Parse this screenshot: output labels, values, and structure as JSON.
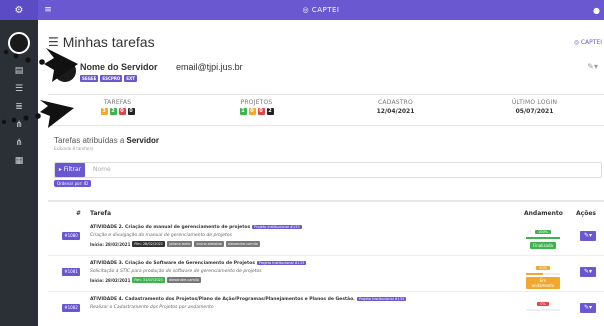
{
  "topbar": {
    "menu_icon": "menu-icon",
    "brand": "CAPTEI",
    "user_icon": "user-icon"
  },
  "sidebar": {
    "icons": [
      "users-icon",
      "list-icon",
      "list-icon",
      "sitemap-icon",
      "sitemap-icon",
      "screens-icon"
    ]
  },
  "page": {
    "title": "Minhas tarefas",
    "right_link": "CAPTEI"
  },
  "profile": {
    "name": "Nome do Servidor",
    "email": "email@tjpi.jus.br",
    "badges": [
      "SEGEE",
      "ESCPRO",
      "EXT"
    ]
  },
  "stats": {
    "tarefas": {
      "label": "TAREFAS",
      "counts": [
        "3",
        "2",
        "0",
        "0"
      ]
    },
    "projetos": {
      "label": "PROJETOS",
      "counts": [
        "1",
        "0",
        "0",
        "2"
      ]
    },
    "cadastro": {
      "label": "CADASTRO",
      "value": "12/04/2021"
    },
    "ultimo_login": {
      "label": "ÚLTIMO LOGIN",
      "value": "05/07/2021"
    }
  },
  "tasks": {
    "heading_prefix": "Tarefas atribuídas a",
    "heading_name": "Servidor",
    "subtitle": "Exibindo 8 tarefa(s)",
    "filter_button": "Filtrar",
    "filter_placeholder": "Nome",
    "order_badge": "Ordenar por: ID",
    "columns": {
      "num": "#",
      "task": "Tarefa",
      "progress": "Andamento",
      "actions": "Ações"
    },
    "rows": [
      {
        "id": "#1080",
        "title": "ATIVIDADE 2. Criação do manual de gerenciamento de projetos",
        "project": "Projeto Institucional #133",
        "desc": "Criação e divulgação do manual de gerenciamento de projetos",
        "start": "Início: 28/02/2021",
        "end": "Fim: 28/02/2021",
        "assignees": [
          "juliana.melo",
          "bruno.almeida",
          "alexandre.camilo"
        ],
        "pct": "100%",
        "progress": 1.0,
        "status": "Finalizada",
        "status_color": "#3fb34f",
        "end_color": "#333"
      },
      {
        "id": "#1081",
        "title": "ATIVIDADE 3. Criação do Software de Gerenciamento de Projetos",
        "project": "Projeto Institucional #133",
        "desc": "Solicitação à STIC para produção do software de gerenciamento de projetos",
        "start": "Início: 28/02/2021",
        "end": "Fim: 31/07/2021",
        "assignees": [
          "alexandre.camilo"
        ],
        "pct": "50%",
        "progress": 0.5,
        "status": "Em andamento",
        "status_color": "#f0a92e",
        "end_color": "#3fb34f"
      },
      {
        "id": "#1082",
        "title": "ATIVIDADE 4. Cadastramento dos Projetos/Plano de Ação/Programas/Planejamentos e Planos de Gestão.",
        "project": "Projeto Institucional #133",
        "desc": "Realizar o Cadastramento dos Projetos por andamento",
        "pct": "0%",
        "progress": 0.0,
        "status": "",
        "status_color": "#e04848"
      }
    ]
  },
  "colors": {
    "accent": "#6a58d0",
    "green": "#3fb34f",
    "orange": "#f0a92e",
    "red": "#e04848",
    "dark": "#222222"
  }
}
